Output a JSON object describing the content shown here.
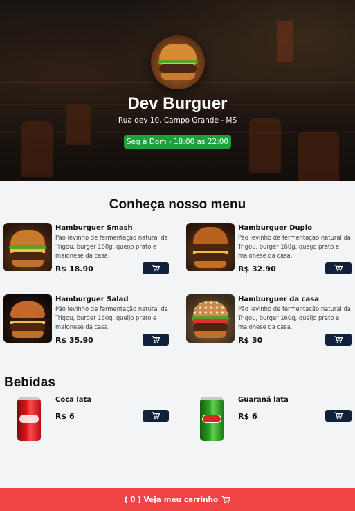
{
  "header": {
    "title": "Dev Burguer",
    "address": "Rua dev 10, Campo Grande - MS",
    "hours": "Seg á Dom - 18:00 as 22:00"
  },
  "menu": {
    "title": "Conheça nosso menu",
    "items": [
      {
        "name": "Hamburguer Smash",
        "description": "Pão levinho de fermentação natural da Trigou, burger 160g, queijo prato e maionese da casa.",
        "price": "R$ 18.90"
      },
      {
        "name": "Hamburguer Duplo",
        "description": "Pão levinho de fermentação natural da Trigou, burger 160g, queijo prato e maionese da casa.",
        "price": "R$ 32.90"
      },
      {
        "name": "Hamburguer Salad",
        "description": "Pão levinho de fermentação natural da Trigou, burger 160g, queijo prato e maionese da casa.",
        "price": "R$ 35.90"
      },
      {
        "name": "Hamburguer da casa",
        "description": "Pão levinho de fermentação natural da Trigou, burger 160g, queijo prato e maionese da casa.",
        "price": "R$ 30"
      }
    ]
  },
  "drinks": {
    "title": "Bebidas",
    "items": [
      {
        "name": "Coca lata",
        "price": "R$ 6"
      },
      {
        "name": "Guaraná lata",
        "price": "R$ 6"
      }
    ]
  },
  "cart": {
    "count_label": "( 0 )",
    "label": "Veja meu carrinho"
  },
  "icons": {
    "cart_button": "cart-plus-icon",
    "footer": "shopping-cart-icon"
  },
  "colors": {
    "footer": "#ef4444",
    "hours_badge": "#1fa13e",
    "cart_button": "#11213a"
  }
}
